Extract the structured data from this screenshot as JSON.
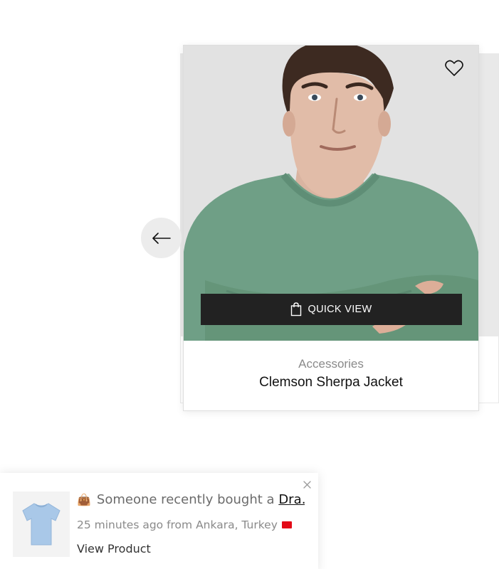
{
  "product_card": {
    "category": "Accessories",
    "name": "Clemson Sherpa Jacket",
    "quick_view_label": "QUICK VIEW"
  },
  "icons": {
    "wishlist": "heart-outline-icon",
    "prev": "arrow-left-icon",
    "quick_view": "shopping-bag-icon",
    "close": "close-icon"
  },
  "notification": {
    "prefix": "Someone recently bought a",
    "product_link": "Dra…",
    "time_location": "25 minutes ago from Ankara, Turkey",
    "view_label": "View Product"
  },
  "colors": {
    "quick_view_bg": "#222222",
    "sweater": "#6f9f86",
    "prev_arrow_bg": "#ececec",
    "thumb_tshirt": "#a9c8e8"
  }
}
